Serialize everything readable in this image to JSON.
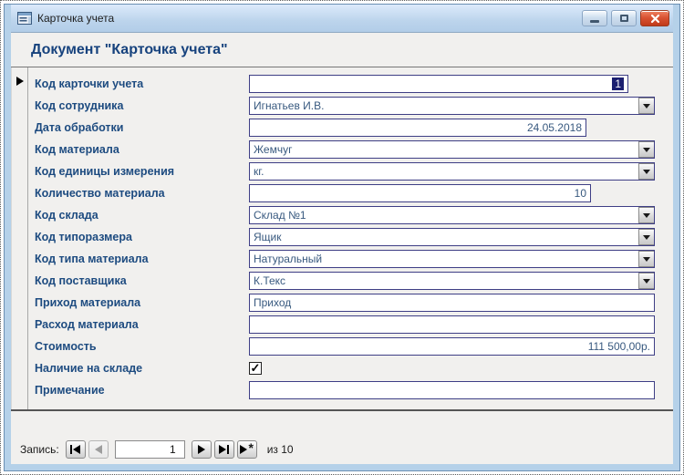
{
  "window": {
    "title": "Карточка учета"
  },
  "header": {
    "title": "Документ \"Карточка учета\""
  },
  "form": {
    "fields": [
      {
        "key": "record-id",
        "label": "Код карточки учета",
        "control": "textbox",
        "value": "1",
        "align": "right",
        "selected": true
      },
      {
        "key": "employee",
        "label": "Код сотрудника",
        "control": "combo",
        "value": "Игнатьев И.В."
      },
      {
        "key": "process-date",
        "label": "Дата обработки",
        "control": "textbox",
        "value": "24.05.2018",
        "align": "right"
      },
      {
        "key": "material",
        "label": "Код материала",
        "control": "combo",
        "value": "Жемчуг"
      },
      {
        "key": "unit",
        "label": "Код единицы измерения",
        "control": "combo",
        "value": "кг."
      },
      {
        "key": "quantity",
        "label": "Количество материала",
        "control": "textbox",
        "value": "10",
        "align": "right"
      },
      {
        "key": "warehouse",
        "label": "Код склада",
        "control": "combo",
        "value": "Склад №1"
      },
      {
        "key": "size-type",
        "label": "Код типоразмера",
        "control": "combo",
        "value": "Ящик"
      },
      {
        "key": "material-type",
        "label": "Код типа материала",
        "control": "combo",
        "value": "Натуральный"
      },
      {
        "key": "supplier",
        "label": "Код поставщика",
        "control": "combo",
        "value": "К.Текс"
      },
      {
        "key": "income",
        "label": "Приход материала",
        "control": "textbox",
        "value": "Приход",
        "align": "left"
      },
      {
        "key": "expense",
        "label": "Расход материала",
        "control": "textbox",
        "value": "",
        "align": "left"
      },
      {
        "key": "cost",
        "label": "Стоимость",
        "control": "textbox",
        "value": "111 500,00р.",
        "align": "right"
      },
      {
        "key": "in-stock",
        "label": "Наличие на складе",
        "control": "checkbox",
        "checked": true,
        "checkmark": "✓"
      },
      {
        "key": "note",
        "label": "Примечание",
        "control": "textbox",
        "value": "",
        "align": "left"
      }
    ]
  },
  "nav": {
    "label": "Запись:",
    "current": "1",
    "of_text": "из 10",
    "buttons": [
      "first-record-icon",
      "previous-record-icon",
      "next-record-icon",
      "last-record-icon",
      "new-record-icon"
    ]
  },
  "colors": {
    "titlebar": "#bcd4ec",
    "window_frame": "#b5d1e9",
    "close_button": "#da5434",
    "label_text": "#1d4b80",
    "field_border": "#3e3e85",
    "field_text": "#38597f",
    "selection_bg": "#1b1f70",
    "form_bg": "#f1f0ee"
  }
}
